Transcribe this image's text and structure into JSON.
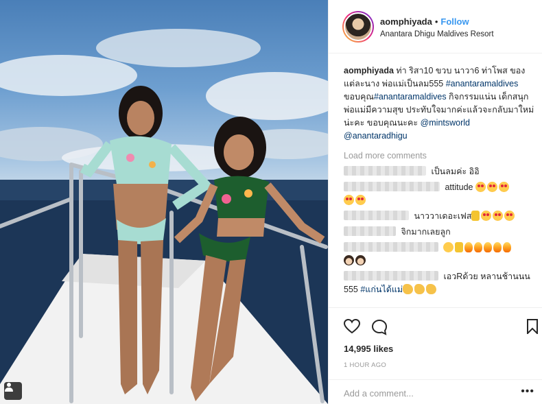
{
  "post": {
    "username": "aomphiyada",
    "dot": "•",
    "follow_label": "Follow",
    "location": "Anantara Dhigu Maldives Resort",
    "caption": {
      "user": "aomphiyada",
      "text": " ท่า ริสา10 ขวบ นาวา6 ท่าโพส ของแต่ละนาง พ่อแม่เป็นลม555 ",
      "tag1": "#anantaramaldives",
      "text2": " ขอบคุณ",
      "tag2": "#anantaramaldives",
      "text3": " กิจกรรมแน่น เด็กสนุก พ่อแม่มีความสุข ประทับใจมากค่ะแล้วจะกลับมาใหม่น่ะคะ ขอบคุณนะคะ ",
      "tag3": "@mintsworld",
      "tag4": "@anantaradhigu"
    },
    "load_more": "Load more comments",
    "comments": [
      {
        "text": " เป็นลมค่ะ อิอิ",
        "emojis": []
      },
      {
        "text": " attitude ",
        "emojis": [
          "star-struck-emoji",
          "star-struck-emoji",
          "star-struck-emoji",
          "star-struck-emoji",
          "star-struck-emoji"
        ]
      },
      {
        "text": " นาววาเดอะเฟส",
        "emojis": [
          "thumbs-up-emoji",
          "star-struck-emoji",
          "star-struck-emoji",
          "star-struck-emoji"
        ]
      },
      {
        "text": " จิกมากเลยลูก",
        "emojis": []
      },
      {
        "text": " ",
        "emojis": [
          "smile-emoji",
          "thumbs-up-emoji",
          "fire-emoji",
          "fire-emoji",
          "fire-emoji",
          "fire-emoji",
          "fire-emoji",
          "girl-emoji",
          "girl-emoji"
        ]
      },
      {
        "text": " เอวRด้วย หลานช้านนน 555 ",
        "tag": "#แก่นได้แม่",
        "emojis": [
          "clap-emoji",
          "clap-emoji",
          "clap-emoji"
        ]
      }
    ],
    "likes": "14,995 likes",
    "time": "1 HOUR AGO",
    "add_comment_placeholder": "Add a comment...",
    "more": "•••"
  }
}
